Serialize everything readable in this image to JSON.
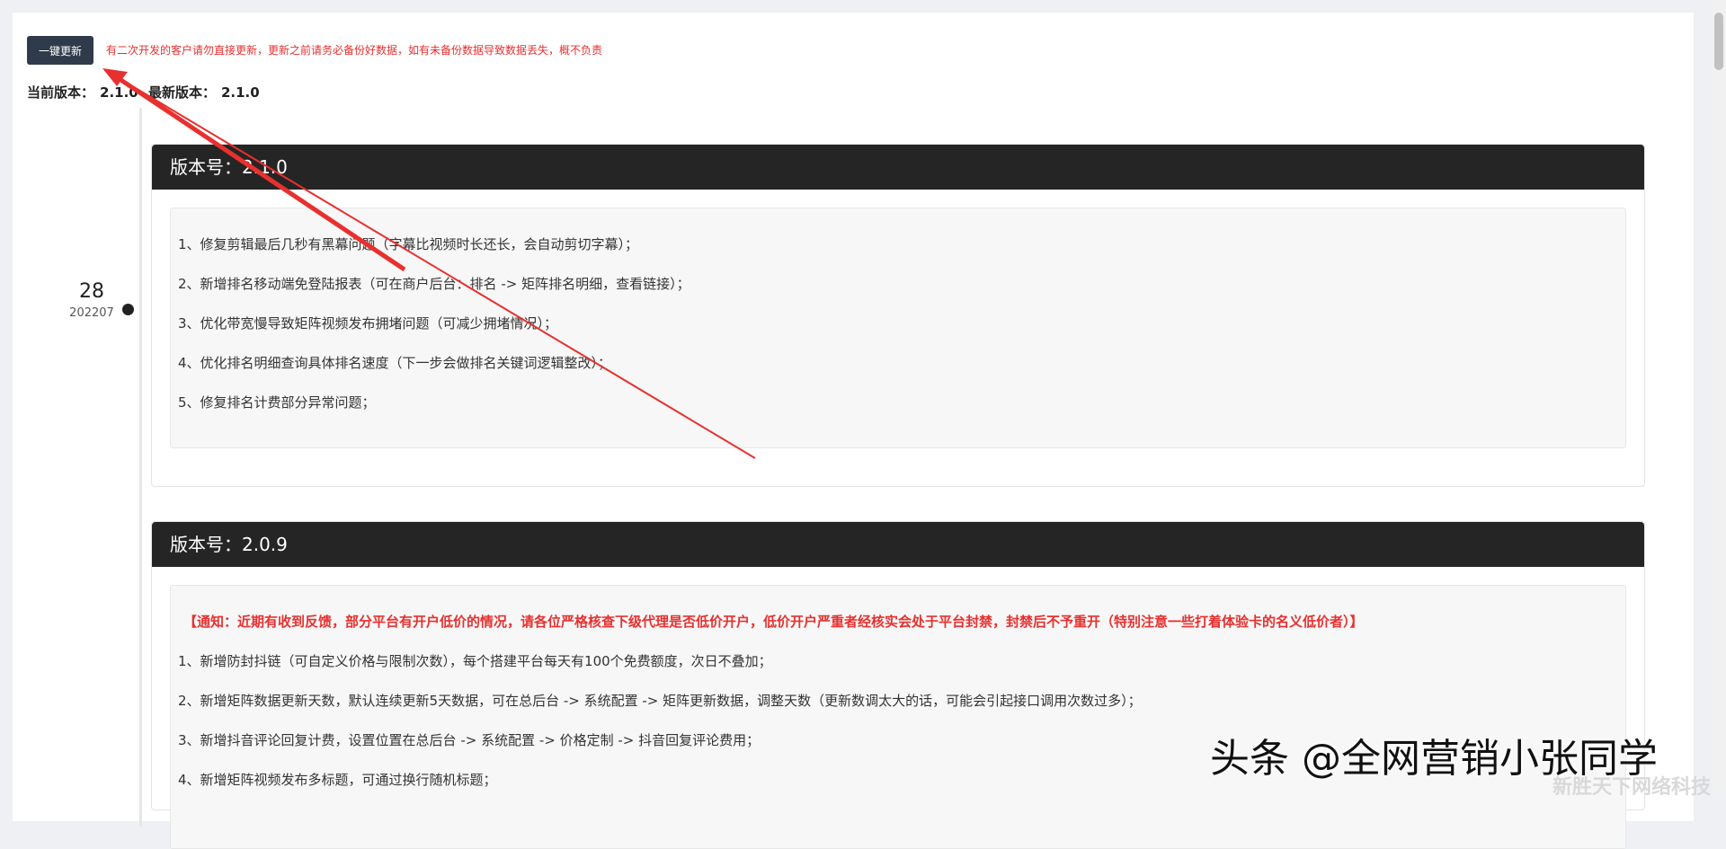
{
  "toolbar": {
    "update_button": "一键更新",
    "warning": "有二次开发的客户请勿直接更新，更新之前请务必备份好数据，如有未备份数据导致数据丢失，概不负责"
  },
  "versions": {
    "current_label": "当前版本：",
    "current_value": "2.1.0",
    "latest_label": "最新版本：",
    "latest_value": "2.1.0"
  },
  "timeline": {
    "day": "28",
    "year_month": "202207"
  },
  "cards": [
    {
      "title": "版本号：2.1.0",
      "items": [
        "1、修复剪辑最后几秒有黑幕问题（字幕比视频时长还长，会自动剪切字幕）；",
        "2、新增排名移动端免登陆报表（可在商户后台：排名 -> 矩阵排名明细，查看链接）；",
        "3、优化带宽慢导致矩阵视频发布拥堵问题（可减少拥堵情况）；",
        "4、优化排名明细查询具体排名速度（下一步会做排名关键词逻辑整改）；",
        "5、修复排名计费部分异常问题；"
      ]
    },
    {
      "title": "版本号：2.0.9",
      "notice": "【通知：近期有收到反馈，部分平台有开户低价的情况，请各位严格核查下级代理是否低价开户，低价开户严重者经核实会处于平台封禁，封禁后不予重开（特别注意一些打着体验卡的名义低价者）】",
      "items": [
        "1、新增防封抖链（可自定义价格与限制次数），每个搭建平台每天有100个免费额度，次日不叠加；",
        "2、新增矩阵数据更新天数，默认连续更新5天数据，可在总后台 -> 系统配置 -> 矩阵更新数据，调整天数（更新数调太大的话，可能会引起接口调用次数过多）；",
        "3、新增抖音评论回复计费，设置位置在总后台 -> 系统配置 -> 价格定制 -> 抖音回复评论费用；",
        "4、新增矩阵视频发布多标题，可通过换行随机标题；"
      ]
    }
  ],
  "overlay": {
    "watermark": "头条 @全网营销小张同学",
    "watermark_small": "新胜天下网络科技",
    "arrow_color": "#e8302f"
  }
}
